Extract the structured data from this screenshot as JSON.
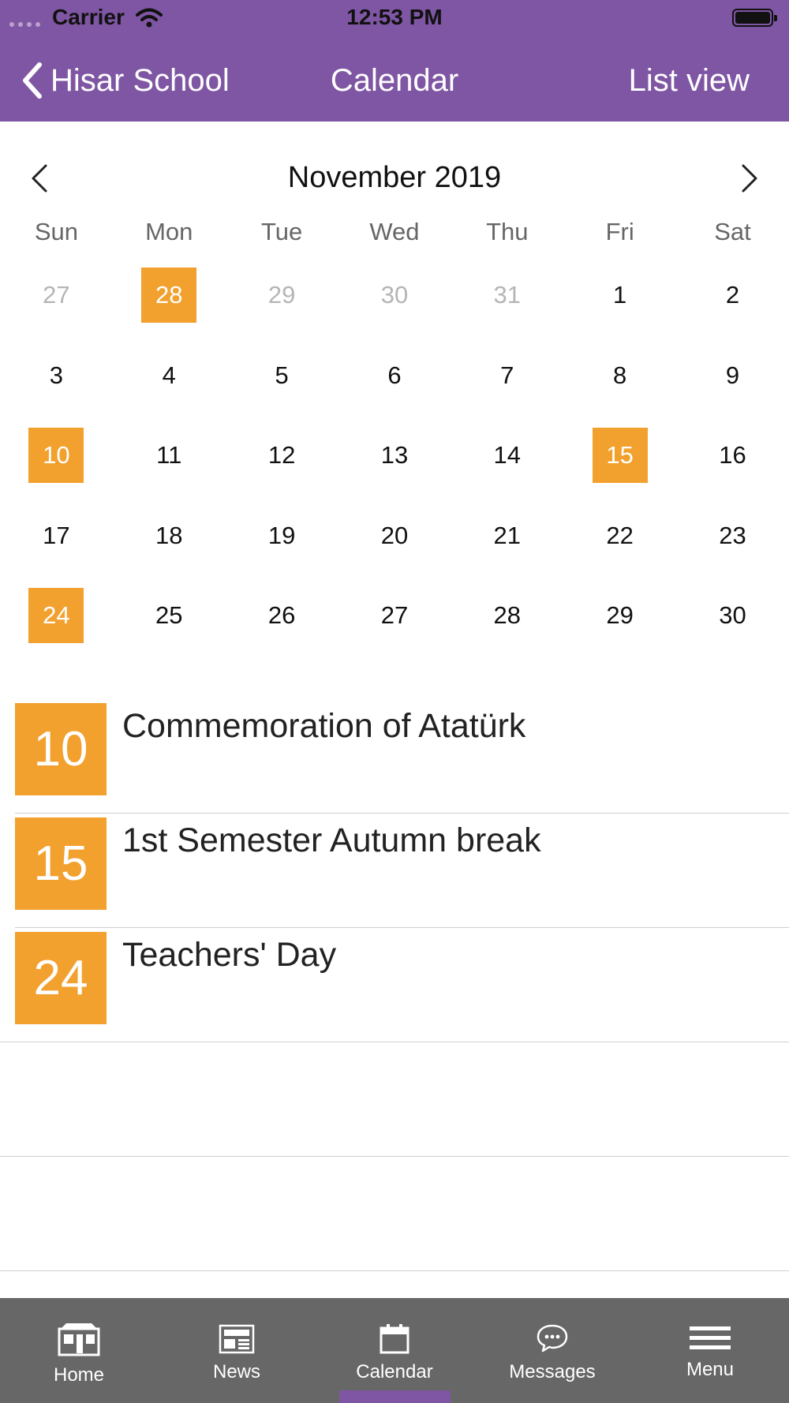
{
  "status_bar": {
    "carrier": "Carrier",
    "time": "12:53 PM"
  },
  "nav": {
    "back_label": "Hisar School",
    "title": "Calendar",
    "right_action": "List view"
  },
  "calendar": {
    "month_title": "November 2019",
    "weekdays": [
      "Sun",
      "Mon",
      "Tue",
      "Wed",
      "Thu",
      "Fri",
      "Sat"
    ],
    "weeks": [
      [
        "27",
        "28",
        "29",
        "30",
        "31",
        "1",
        "2"
      ],
      [
        "3",
        "4",
        "5",
        "6",
        "7",
        "8",
        "9"
      ],
      [
        "10",
        "11",
        "12",
        "13",
        "14",
        "15",
        "16"
      ],
      [
        "17",
        "18",
        "19",
        "20",
        "21",
        "22",
        "23"
      ],
      [
        "24",
        "25",
        "26",
        "27",
        "28",
        "29",
        "30"
      ]
    ],
    "muted_cells": [
      "0-0",
      "0-2",
      "0-3",
      "0-4"
    ],
    "highlighted_cells": [
      "0-1",
      "2-0",
      "2-5",
      "4-0"
    ]
  },
  "events": [
    {
      "day": "10",
      "title": "Commemoration of Atatürk"
    },
    {
      "day": "15",
      "title": "1st Semester Autumn break"
    },
    {
      "day": "24",
      "title": "Teachers' Day"
    }
  ],
  "tabbar": {
    "tabs": [
      {
        "label": "Home",
        "icon": "home-icon"
      },
      {
        "label": "News",
        "icon": "news-icon"
      },
      {
        "label": "Calendar",
        "icon": "calendar-icon",
        "active": true
      },
      {
        "label": "Messages",
        "icon": "messages-icon"
      },
      {
        "label": "Menu",
        "icon": "menu-icon"
      }
    ]
  },
  "colors": {
    "brand": "#7f56a3",
    "highlight": "#f2a12e",
    "tabbar": "#676767"
  }
}
